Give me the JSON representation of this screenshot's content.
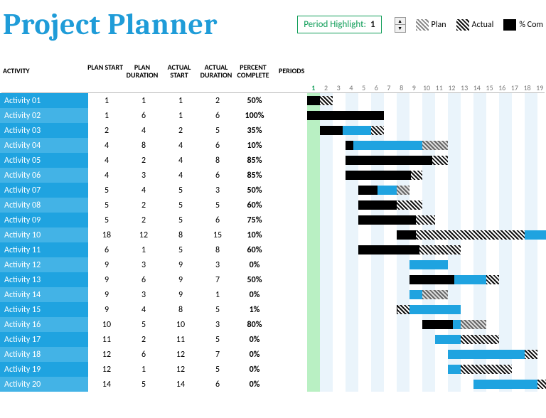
{
  "title": "Project Planner",
  "legend": {
    "highlight_label": "Period Highlight:",
    "highlight_value": "1",
    "plan": "Plan",
    "actual": "Actual",
    "complete": "% Com"
  },
  "columns": {
    "activity": "ACTIVITY",
    "plan_start": "PLAN START",
    "plan_duration": "PLAN DURATION",
    "actual_start": "ACTUAL START",
    "actual_duration": "ACTUAL DURATION",
    "percent_complete": "PERCENT COMPLETE",
    "periods": "PERIODS"
  },
  "period_count": 19,
  "period_highlight": 1,
  "chart_data": {
    "type": "gantt",
    "periods": [
      1,
      2,
      3,
      4,
      5,
      6,
      7,
      8,
      9,
      10,
      11,
      12,
      13,
      14,
      15,
      16,
      17,
      18,
      19
    ],
    "activities": [
      {
        "name": "Activity 01",
        "plan_start": 1,
        "plan_duration": 1,
        "actual_start": 1,
        "actual_duration": 2,
        "percent_complete": 50
      },
      {
        "name": "Activity 02",
        "plan_start": 1,
        "plan_duration": 6,
        "actual_start": 1,
        "actual_duration": 6,
        "percent_complete": 100
      },
      {
        "name": "Activity 03",
        "plan_start": 2,
        "plan_duration": 4,
        "actual_start": 2,
        "actual_duration": 5,
        "percent_complete": 35
      },
      {
        "name": "Activity 04",
        "plan_start": 4,
        "plan_duration": 8,
        "actual_start": 4,
        "actual_duration": 6,
        "percent_complete": 10
      },
      {
        "name": "Activity 05",
        "plan_start": 4,
        "plan_duration": 2,
        "actual_start": 4,
        "actual_duration": 8,
        "percent_complete": 85
      },
      {
        "name": "Activity 06",
        "plan_start": 4,
        "plan_duration": 3,
        "actual_start": 4,
        "actual_duration": 6,
        "percent_complete": 85
      },
      {
        "name": "Activity 07",
        "plan_start": 5,
        "plan_duration": 4,
        "actual_start": 5,
        "actual_duration": 3,
        "percent_complete": 50
      },
      {
        "name": "Activity 08",
        "plan_start": 5,
        "plan_duration": 2,
        "actual_start": 5,
        "actual_duration": 5,
        "percent_complete": 60
      },
      {
        "name": "Activity 09",
        "plan_start": 5,
        "plan_duration": 2,
        "actual_start": 5,
        "actual_duration": 6,
        "percent_complete": 75
      },
      {
        "name": "Activity 10",
        "plan_start": 18,
        "plan_duration": 12,
        "actual_start": 8,
        "actual_duration": 15,
        "percent_complete": 10
      },
      {
        "name": "Activity 11",
        "plan_start": 6,
        "plan_duration": 1,
        "actual_start": 5,
        "actual_duration": 8,
        "percent_complete": 60
      },
      {
        "name": "Activity 12",
        "plan_start": 9,
        "plan_duration": 3,
        "actual_start": 9,
        "actual_duration": 3,
        "percent_complete": 0
      },
      {
        "name": "Activity 13",
        "plan_start": 9,
        "plan_duration": 6,
        "actual_start": 9,
        "actual_duration": 7,
        "percent_complete": 50
      },
      {
        "name": "Activity 14",
        "plan_start": 9,
        "plan_duration": 3,
        "actual_start": 9,
        "actual_duration": 1,
        "percent_complete": 0
      },
      {
        "name": "Activity 15",
        "plan_start": 9,
        "plan_duration": 4,
        "actual_start": 8,
        "actual_duration": 5,
        "percent_complete": 1
      },
      {
        "name": "Activity 16",
        "plan_start": 10,
        "plan_duration": 5,
        "actual_start": 10,
        "actual_duration": 3,
        "percent_complete": 80
      },
      {
        "name": "Activity 17",
        "plan_start": 11,
        "plan_duration": 2,
        "actual_start": 11,
        "actual_duration": 5,
        "percent_complete": 0
      },
      {
        "name": "Activity 18",
        "plan_start": 12,
        "plan_duration": 6,
        "actual_start": 12,
        "actual_duration": 7,
        "percent_complete": 0
      },
      {
        "name": "Activity 19",
        "plan_start": 12,
        "plan_duration": 1,
        "actual_start": 12,
        "actual_duration": 5,
        "percent_complete": 0
      },
      {
        "name": "Activity 20",
        "plan_start": 14,
        "plan_duration": 5,
        "actual_start": 14,
        "actual_duration": 6,
        "percent_complete": 0
      }
    ]
  }
}
